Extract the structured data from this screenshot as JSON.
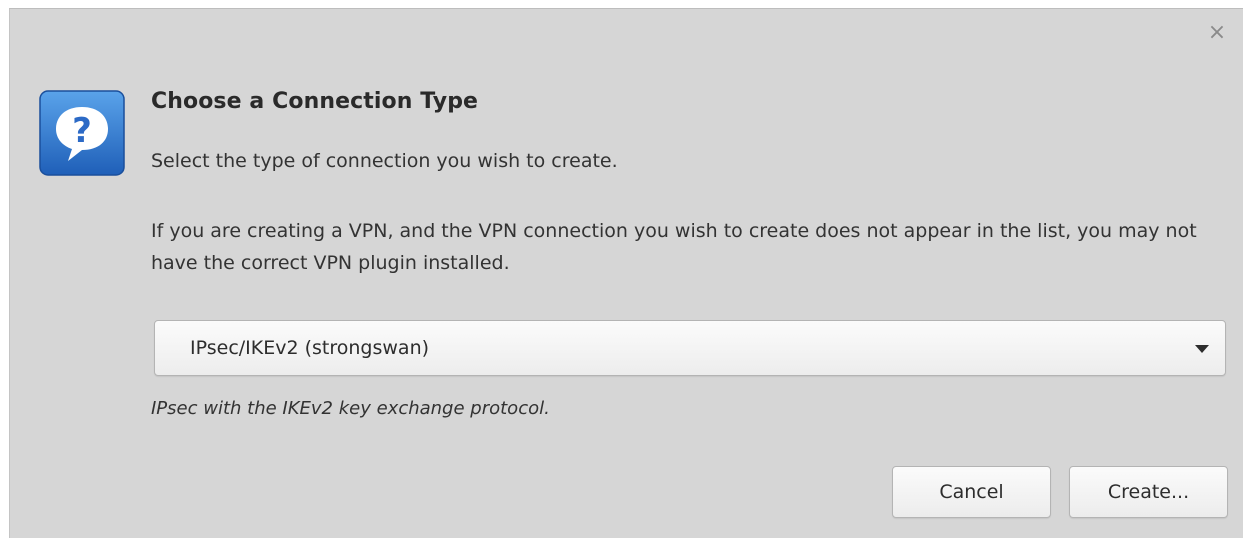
{
  "dialog": {
    "close_glyph": "×",
    "icon": "question-bubble-icon",
    "title": "Choose a Connection Type",
    "subtitle": "Select the type of connection you wish to create.",
    "info": "If you are creating a VPN, and the VPN connection you wish to create does not appear in the list, you may not have the correct VPN plugin installed.",
    "connection_type": {
      "selected": "IPsec/IKEv2 (strongswan)",
      "description": "IPsec with the IKEv2 key exchange protocol."
    },
    "buttons": {
      "cancel": "Cancel",
      "create": "Create..."
    },
    "colors": {
      "background": "#d6d6d6",
      "icon_blue": "#2f7bd4"
    }
  }
}
